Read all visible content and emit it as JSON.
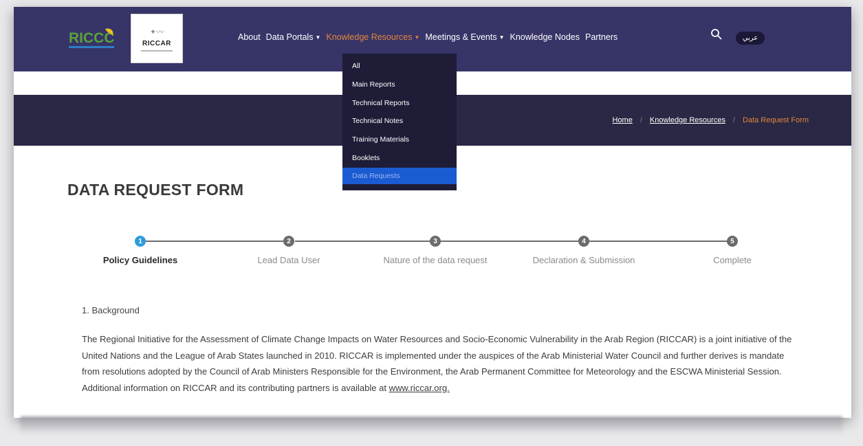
{
  "header": {
    "logo_primary": {
      "text": "RICCC",
      "color_main": "#5aa23a",
      "color_accent": "#f0c020"
    },
    "logo_secondary": {
      "word": "RICCAR"
    },
    "nav": [
      {
        "label": "About",
        "dropdown": false,
        "active": false
      },
      {
        "label": "Data Portals",
        "dropdown": true,
        "active": false
      },
      {
        "label": "Knowledge Resources",
        "dropdown": true,
        "active": true
      },
      {
        "label": "Meetings & Events",
        "dropdown": true,
        "active": false
      },
      {
        "label": "Knowledge Nodes",
        "dropdown": false,
        "active": false
      },
      {
        "label": "Partners",
        "dropdown": false,
        "active": false
      }
    ],
    "search_icon": "search-icon",
    "language_toggle": "عربي",
    "background": "#373468",
    "active_color": "#e3863b"
  },
  "dropdown": {
    "items": [
      "All",
      "Main Reports",
      "Technical Reports",
      "Technical Notes",
      "Training Materials",
      "Booklets",
      "Data Requests"
    ],
    "selected_index": 6,
    "selected_color": "#1b5bd1"
  },
  "banner": {
    "breadcrumb": [
      {
        "label": "Home",
        "link": true
      },
      {
        "label": "Knowledge Resources",
        "link": true
      },
      {
        "label": "Data Request Form",
        "link": false
      }
    ],
    "background": "#2a2844"
  },
  "page": {
    "title": "DATA REQUEST FORM",
    "steps": [
      {
        "number": "1",
        "label": "Policy Guidelines",
        "active": true
      },
      {
        "number": "2",
        "label": "Lead Data User",
        "active": false
      },
      {
        "number": "3",
        "label": "Nature of the data request",
        "active": false
      },
      {
        "number": "4",
        "label": "Declaration & Submission",
        "active": false
      },
      {
        "number": "5",
        "label": "Complete",
        "active": false
      }
    ],
    "step_active_color": "#2d9cdb",
    "section_heading": "1. Background",
    "paragraph_text": "The Regional Initiative for the Assessment of Climate Change Impacts on Water Resources and Socio-Economic Vulnerability in the Arab Region (RICCAR) is a joint initiative of the United Nations and the League of Arab States launched in 2010. RICCAR is implemented under the auspices of the Arab Ministerial Water Council and further derives is mandate from resolutions adopted by the Council of Arab Ministers Responsible for the Environment, the Arab Permanent Committee for Meteorology and the ESCWA Ministerial Session. Additional information on RICCAR and its contributing partners is available at ",
    "paragraph_link": "www.riccar.org."
  }
}
